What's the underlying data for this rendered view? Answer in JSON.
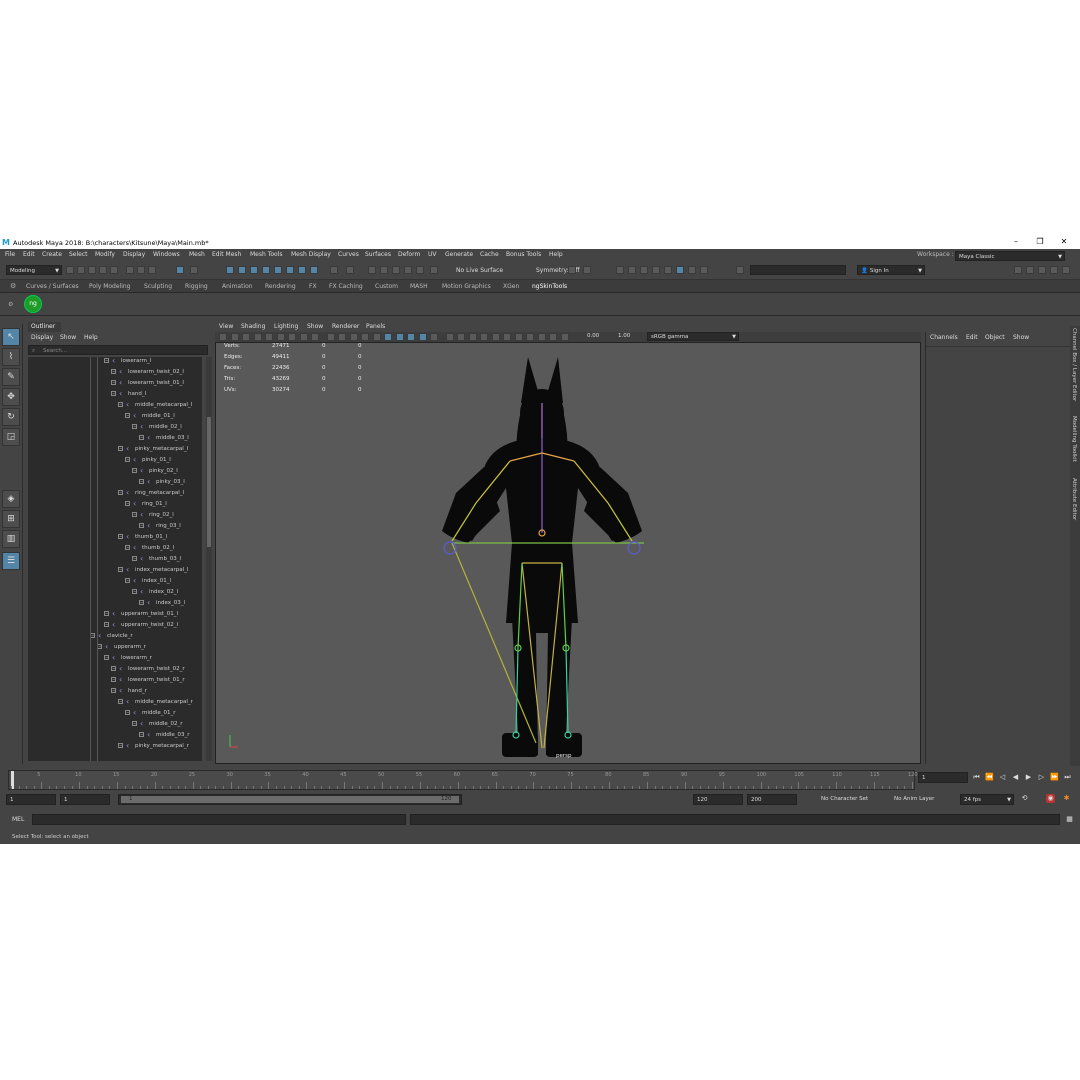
{
  "title": "Autodesk Maya 2018: B:\\characters\\Kitsune\\Maya\\Main.mb*",
  "menu": [
    "File",
    "Edit",
    "Create",
    "Select",
    "Modify",
    "Display",
    "Windows",
    "Mesh",
    "Edit Mesh",
    "Mesh Tools",
    "Mesh Display",
    "Curves",
    "Surfaces",
    "Deform",
    "UV",
    "Generate",
    "Cache",
    "Bonus Tools",
    "Help"
  ],
  "workspace": {
    "label": "Workspace :",
    "value": "Maya Classic"
  },
  "status": {
    "menuset": "Modeling",
    "live_surface": "No Live Surface",
    "symmetry": "Symmetry: Off",
    "sign_in": "Sign In"
  },
  "shelf_tabs": [
    "Curves / Surfaces",
    "Poly Modeling",
    "Sculpting",
    "Rigging",
    "Animation",
    "Rendering",
    "FX",
    "FX Caching",
    "Custom",
    "MASH",
    "Motion Graphics",
    "XGen",
    "ngSkinTools"
  ],
  "outliner": {
    "title": "Outliner",
    "menu": [
      "Display",
      "Show",
      "Help"
    ],
    "search_placeholder": "Search...",
    "items": [
      {
        "label": "lowerarm_l",
        "depth": 0
      },
      {
        "label": "lowerarm_twist_02_l",
        "depth": 1
      },
      {
        "label": "lowerarm_twist_01_l",
        "depth": 1
      },
      {
        "label": "hand_l",
        "depth": 1
      },
      {
        "label": "middle_metacarpal_l",
        "depth": 2
      },
      {
        "label": "middle_01_l",
        "depth": 3
      },
      {
        "label": "middle_02_l",
        "depth": 4
      },
      {
        "label": "middle_03_l",
        "depth": 5
      },
      {
        "label": "pinky_metacarpal_l",
        "depth": 2
      },
      {
        "label": "pinky_01_l",
        "depth": 3
      },
      {
        "label": "pinky_02_l",
        "depth": 4
      },
      {
        "label": "pinky_03_l",
        "depth": 5
      },
      {
        "label": "ring_metacarpal_l",
        "depth": 2
      },
      {
        "label": "ring_01_l",
        "depth": 3
      },
      {
        "label": "ring_02_l",
        "depth": 4
      },
      {
        "label": "ring_03_l",
        "depth": 5
      },
      {
        "label": "thumb_01_l",
        "depth": 2
      },
      {
        "label": "thumb_02_l",
        "depth": 3
      },
      {
        "label": "thumb_03_l",
        "depth": 4
      },
      {
        "label": "index_metacarpal_l",
        "depth": 2
      },
      {
        "label": "index_01_l",
        "depth": 3
      },
      {
        "label": "index_02_l",
        "depth": 4
      },
      {
        "label": "index_03_l",
        "depth": 5
      },
      {
        "label": "upperarm_twist_01_l",
        "depth": 0
      },
      {
        "label": "upperarm_twist_02_l",
        "depth": 0
      },
      {
        "label": "clavicle_r",
        "depth": -2
      },
      {
        "label": "upperarm_r",
        "depth": -1
      },
      {
        "label": "lowerarm_r",
        "depth": 0
      },
      {
        "label": "lowerarm_twist_02_r",
        "depth": 1
      },
      {
        "label": "lowerarm_twist_01_r",
        "depth": 1
      },
      {
        "label": "hand_r",
        "depth": 1
      },
      {
        "label": "middle_metacarpal_r",
        "depth": 2
      },
      {
        "label": "middle_01_r",
        "depth": 3
      },
      {
        "label": "middle_02_r",
        "depth": 4
      },
      {
        "label": "middle_03_r",
        "depth": 5
      },
      {
        "label": "pinky_metacarpal_r",
        "depth": 2
      }
    ]
  },
  "viewport": {
    "menu": [
      "View",
      "Shading",
      "Lighting",
      "Show",
      "Renderer",
      "Panels"
    ],
    "exposure": "0.00",
    "gamma": "1.00",
    "colorspace": "sRGB gamma",
    "camera": "persp",
    "hud": [
      {
        "label": "Verts:",
        "a": "27471",
        "b": "0",
        "c": "0"
      },
      {
        "label": "Edges:",
        "a": "49411",
        "b": "0",
        "c": "0"
      },
      {
        "label": "Faces:",
        "a": "22436",
        "b": "0",
        "c": "0"
      },
      {
        "label": "Tris:",
        "a": "43269",
        "b": "0",
        "c": "0"
      },
      {
        "label": "UVs:",
        "a": "30274",
        "b": "0",
        "c": "0"
      }
    ]
  },
  "channel_box": {
    "menu": [
      "Channels",
      "Edit",
      "Object",
      "Show"
    ]
  },
  "side_tabs": [
    "Channel Box / Layer Editor",
    "Modelling Toolkit",
    "Attribute Editor"
  ],
  "timeline": {
    "ticks": [
      "5",
      "10",
      "15",
      "20",
      "25",
      "30",
      "35",
      "40",
      "45",
      "50",
      "55",
      "60",
      "65",
      "70",
      "75",
      "80",
      "85",
      "90",
      "95",
      "100",
      "105",
      "110",
      "115",
      "120"
    ],
    "current": "1"
  },
  "range": {
    "start": "1",
    "anim_start": "1",
    "slider_start": "1",
    "slider_end": "120",
    "end": "120",
    "anim_end": "200",
    "character_set": "No Character Set",
    "anim_layer": "No Anim Layer",
    "fps": "24 fps"
  },
  "command": {
    "lang": "MEL"
  },
  "help": "Select Tool: select an object",
  "colors": {
    "accent": "#5285a6",
    "app_bg": "#444444",
    "viewport_bg": "#595959"
  }
}
